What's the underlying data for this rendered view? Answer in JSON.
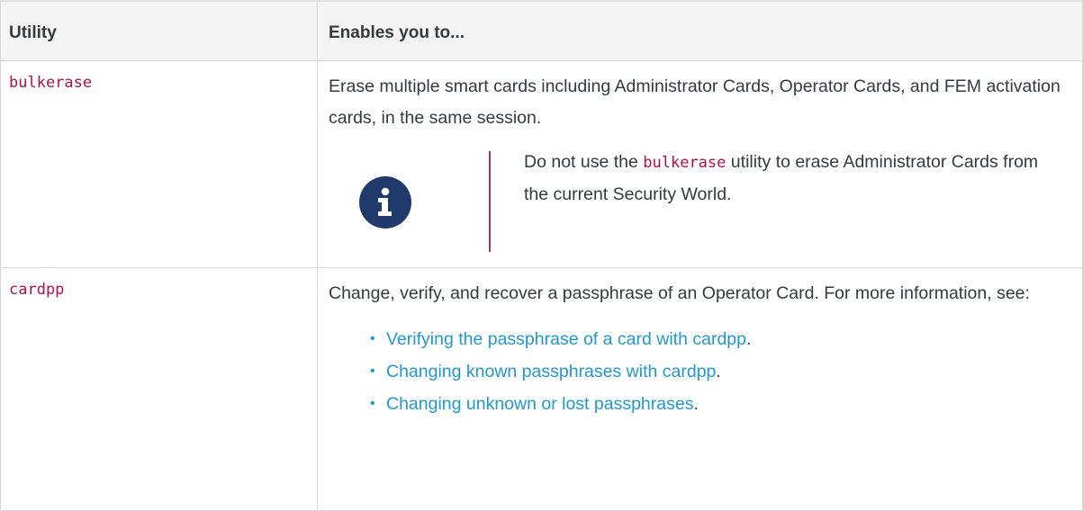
{
  "table": {
    "headers": [
      "Utility",
      "Enables you to..."
    ],
    "rows": [
      {
        "utility": "bulkerase",
        "description": "Erase multiple smart cards including Administrator Cards, Operator Cards, and FEM activation cards, in the same session.",
        "note": {
          "icon": "info-icon",
          "text_before": "Do not use the ",
          "code": "bulkerase",
          "text_after": " utility to erase Administrator Cards from the current Security World."
        }
      },
      {
        "utility": "cardpp",
        "description": "Change, verify, and recover a passphrase of an Operator Card. For more information, see:",
        "links": [
          "Verifying the passphrase of a card with cardpp",
          "Changing known passphrases with cardpp",
          "Changing unknown or lost passphrases"
        ]
      }
    ]
  },
  "colors": {
    "code": "#b0104a",
    "link": "#1f98d4",
    "note_icon_bg": "#1f3a6b",
    "note_bar": "#9b3a6a"
  }
}
